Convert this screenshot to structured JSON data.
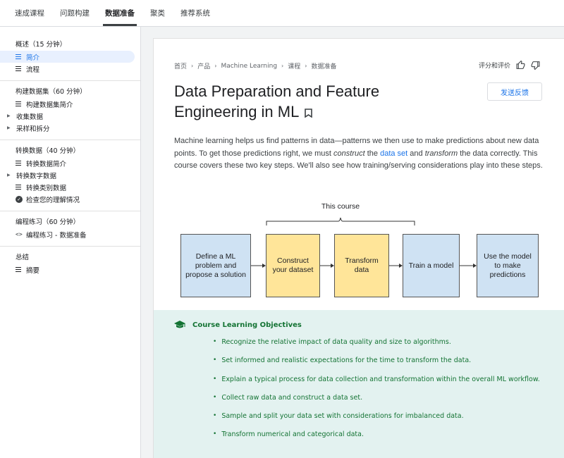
{
  "topnav": {
    "tabs": [
      {
        "label": "速成课程",
        "active": false
      },
      {
        "label": "问题构建",
        "active": false
      },
      {
        "label": "数据准备",
        "active": true
      },
      {
        "label": "聚类",
        "active": false
      },
      {
        "label": "推荐系统",
        "active": false
      }
    ]
  },
  "sidebar": {
    "sections": [
      {
        "title": "概述（15 分钟）",
        "items": [
          {
            "label": "简介",
            "icon": "lines-icon",
            "active": true
          },
          {
            "label": "流程",
            "icon": "lines-icon",
            "active": false
          }
        ]
      },
      {
        "title": "构建数据集（60 分钟）",
        "items": [
          {
            "label": "构建数据集简介",
            "icon": "lines-icon",
            "active": false
          },
          {
            "label": "收集数据",
            "icon": "expand-icon",
            "active": false
          },
          {
            "label": "采样和拆分",
            "icon": "expand-icon",
            "active": false
          }
        ]
      },
      {
        "title": "转换数据（40 分钟）",
        "items": [
          {
            "label": "转换数据简介",
            "icon": "lines-icon",
            "active": false
          },
          {
            "label": "转换数字数据",
            "icon": "expand-icon",
            "active": false
          },
          {
            "label": "转换类别数据",
            "icon": "lines-icon",
            "active": false
          },
          {
            "label": "检查您的理解情况",
            "icon": "check-icon",
            "active": false
          }
        ]
      },
      {
        "title": "编程练习（60 分钟）",
        "items": [
          {
            "label": "编程练习 - 数据准备",
            "icon": "code-icon",
            "active": false
          }
        ]
      },
      {
        "title": "总结",
        "items": [
          {
            "label": "摘要",
            "icon": "lines-icon",
            "active": false
          }
        ]
      }
    ]
  },
  "breadcrumb": [
    "首页",
    "产品",
    "Machine Learning",
    "课程",
    "数据准备"
  ],
  "rating_label": "评分和评价",
  "title": "Data Preparation and Feature Engineering in ML",
  "feedback_button": "发送反馈",
  "intro": {
    "p1": "Machine learning helps us find patterns in data—patterns we then use to make predictions about new data points. To get those predictions right, we must ",
    "em1": "construct",
    "p2": " the ",
    "link": "data set",
    "p3": " and ",
    "em2": "transform",
    "p4": " the data correctly. This course covers these two key steps. We'll also see how training/serving considerations play into these steps."
  },
  "diagram": {
    "course_label": "This course",
    "steps": [
      "Define a ML problem and propose a solution",
      "Construct your dataset",
      "Transform data",
      "Train a model",
      "Use the model to make predictions"
    ],
    "colors": {
      "blue": "#cfe2f3",
      "yellow": "#ffe599"
    }
  },
  "objectives": {
    "heading": "Course Learning Objectives",
    "items": [
      "Recognize the relative impact of data quality and size to algorithms.",
      "Set informed and realistic expectations for the time to transform the data.",
      "Explain a typical process for data collection and transformation within the overall ML workflow.",
      "Collect raw data and construct a data set.",
      "Sample and split your data set with considerations for imbalanced data.",
      "Transform numerical and categorical data."
    ]
  }
}
